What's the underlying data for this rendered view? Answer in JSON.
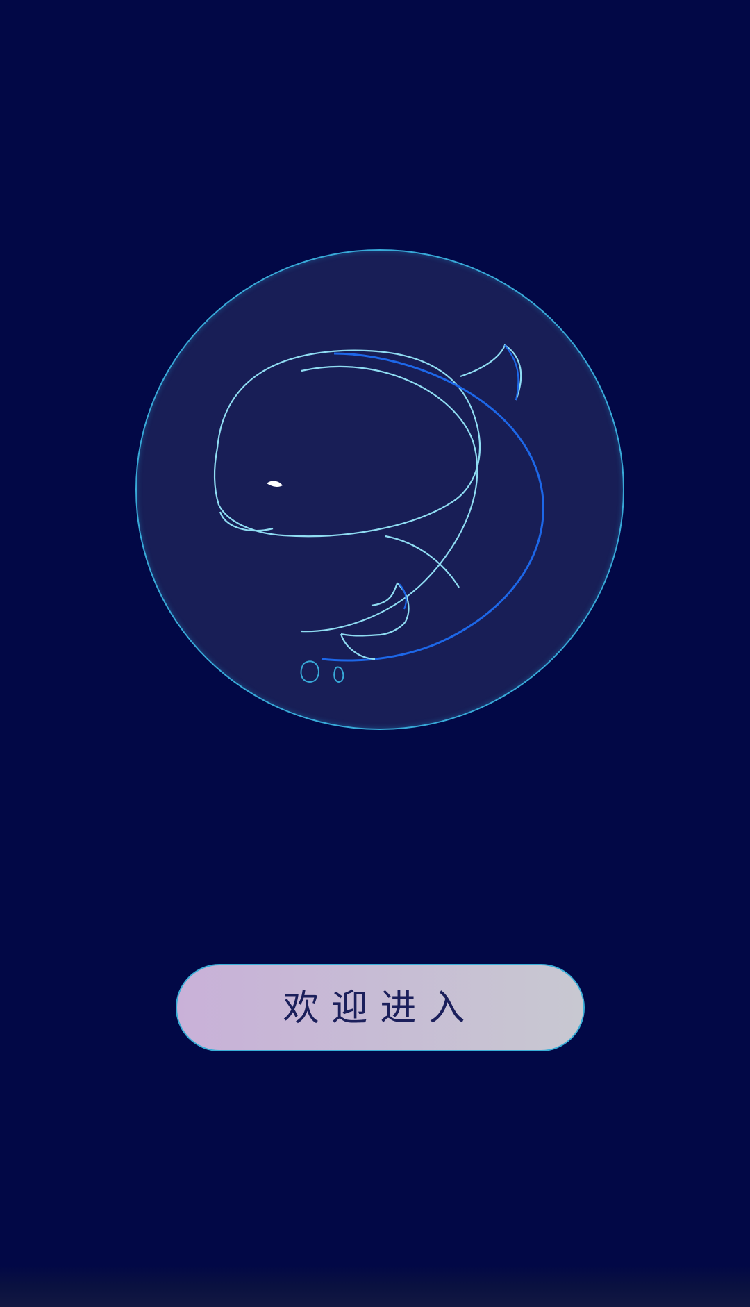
{
  "app": {
    "logo": {
      "icon": "whale-icon",
      "colors": {
        "circle_fill": "#1a2154",
        "circle_stroke": "#38a9d8",
        "line_light": "#8fdcf2",
        "line_blue": "#1d67e8",
        "eye": "#ffffff"
      }
    },
    "actions": {
      "enter_label": "欢迎进入"
    },
    "colors": {
      "background": "#020846",
      "button_gradient_start": "#c9b1d8",
      "button_gradient_end": "#c8c8d1",
      "button_text": "#1b1f5b"
    }
  }
}
